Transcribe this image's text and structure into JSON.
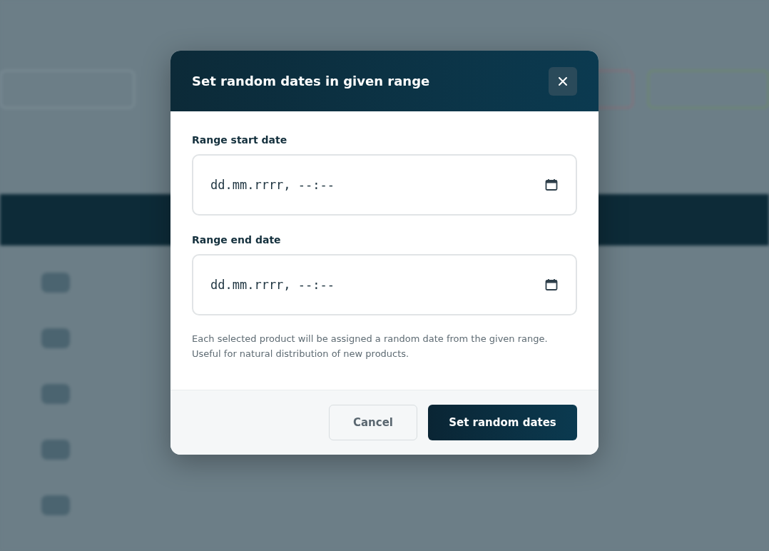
{
  "dialog": {
    "title": "Set random dates in given range",
    "fields": [
      {
        "label": "Range start date",
        "placeholder": "dd.mm.rrrr, --:--"
      },
      {
        "label": "Range end date",
        "placeholder": "dd.mm.rrrr, --:--"
      }
    ],
    "help_text": "Each selected product will be assigned a random date from the given range. Useful for natural distribution of new products.",
    "buttons": [
      {
        "label": "Cancel",
        "kind": "secondary"
      },
      {
        "label": "Set random dates",
        "kind": "primary"
      }
    ]
  }
}
